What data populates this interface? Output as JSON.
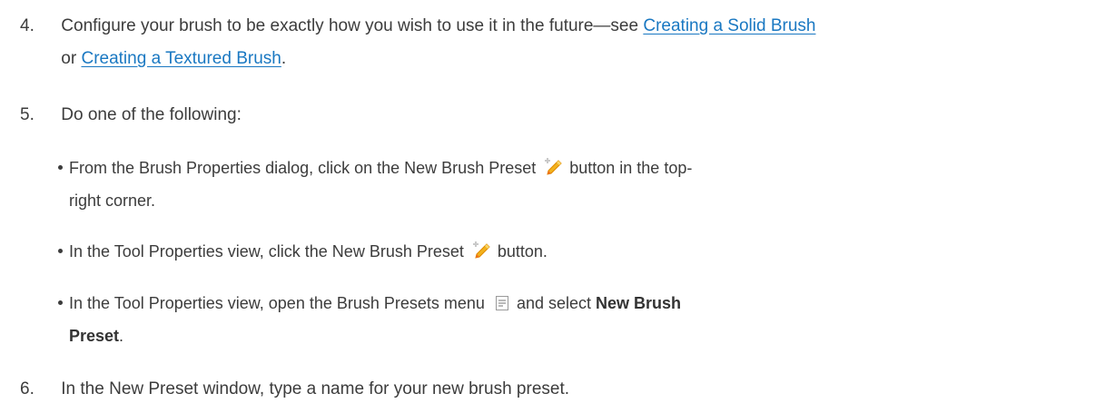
{
  "step4": {
    "num": "4.",
    "text_before": "Configure your brush to be exactly how you wish to use it in the future—see ",
    "link1": "Creating a Solid Brush",
    "or": "or ",
    "link2": "Creating a Textured Brush",
    "period": "."
  },
  "step5": {
    "num": "5.",
    "text": "Do one of the following:"
  },
  "bullets": {
    "b1_before": "From the Brush Properties dialog, click on the New Brush Preset ",
    "b1_after": " button in the top-",
    "b1_line2": "right corner.",
    "b2_before": "In the Tool Properties view, click the New Brush Preset ",
    "b2_after": " button.",
    "b3_before": "In the Tool Properties view, open the Brush Presets menu ",
    "b3_mid": "and select ",
    "b3_bold1": "New Brush",
    "b3_bold2": "Preset",
    "b3_end": "."
  },
  "step6": {
    "num": "6.",
    "text": "In the New Preset window, type a name for your new brush preset."
  },
  "icons": {
    "preset": "new-brush-preset-icon",
    "menu": "brush-presets-menu-icon"
  },
  "colors": {
    "link": "#1a78c2",
    "text": "#3c3c3c"
  }
}
